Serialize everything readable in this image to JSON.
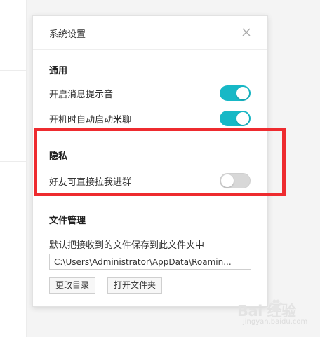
{
  "dialog": {
    "title": "系统设置",
    "sections": {
      "general": {
        "title": "通用",
        "items": [
          {
            "label": "开启消息提示音",
            "enabled": true
          },
          {
            "label": "开机时自动启动米聊",
            "enabled": true
          }
        ]
      },
      "privacy": {
        "title": "隐私",
        "items": [
          {
            "label": "好友可直接拉我进群",
            "enabled": false
          }
        ]
      },
      "files": {
        "title": "文件管理",
        "description": "默认把接收到的文件保存到此文件夹中",
        "path_value": "C:\\Users\\Administrator\\AppData\\Roamin...",
        "change_dir_label": "更改目录",
        "open_folder_label": "打开文件夹"
      }
    }
  },
  "colors": {
    "toggle_on": "#17b8c6",
    "toggle_off": "#d8d8d8",
    "highlight": "#ee2b2f"
  },
  "icons": {
    "close": "close-icon",
    "watermark": "baidu-paw-icon"
  },
  "watermark": {
    "text": "Bai 经验",
    "sub": "jingyan.baidu.com"
  }
}
